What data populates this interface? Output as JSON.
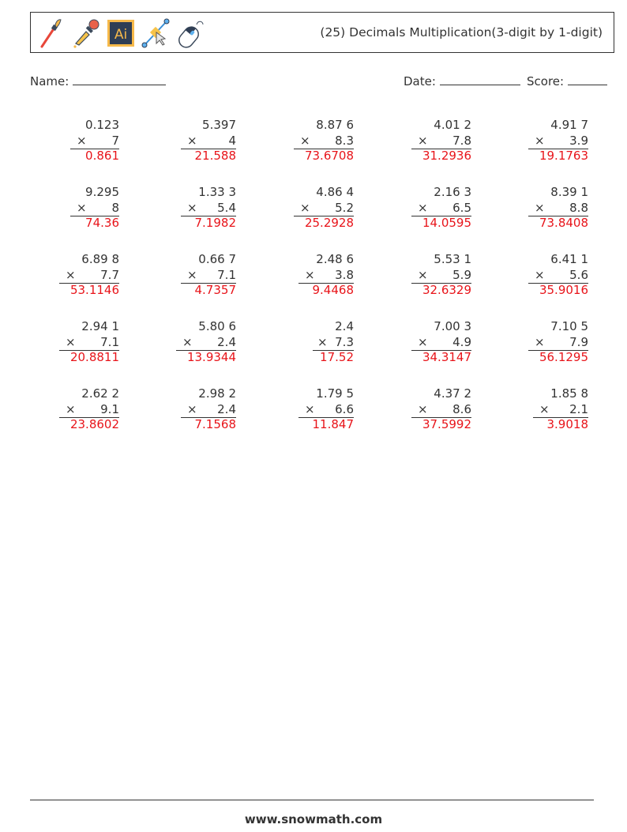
{
  "header": {
    "icons": [
      "paintbrush-icon",
      "eyedropper-icon",
      "illustrator-icon",
      "pen-tool-icon",
      "mouse-icon"
    ],
    "illustrator_label": "Ai",
    "title": "(25) Decimals Multiplication(3-digit by 1-digit)"
  },
  "fields": {
    "name_label": "Name:",
    "date_label": "Date:",
    "score_label": "Score:"
  },
  "operator": "×",
  "problems": [
    [
      {
        "top": "0.123",
        "bottom": "7",
        "answer": "0.861"
      },
      {
        "top": "5.397",
        "bottom": "4",
        "answer": "21.588"
      },
      {
        "top": "8.87 6",
        "bottom": "8.3",
        "answer": "73.6708"
      },
      {
        "top": "4.01 2",
        "bottom": "7.8",
        "answer": "31.2936"
      },
      {
        "top": "4.91 7",
        "bottom": "3.9",
        "answer": "19.1763"
      }
    ],
    [
      {
        "top": "9.295",
        "bottom": "8",
        "answer": "74.36"
      },
      {
        "top": "1.33 3",
        "bottom": "5.4",
        "answer": "7.1982"
      },
      {
        "top": "4.86 4",
        "bottom": "5.2",
        "answer": "25.2928"
      },
      {
        "top": "2.16 3",
        "bottom": "6.5",
        "answer": "14.0595"
      },
      {
        "top": "8.39 1",
        "bottom": "8.8",
        "answer": "73.8408"
      }
    ],
    [
      {
        "top": "6.89 8",
        "bottom": "7.7",
        "answer": "53.1146"
      },
      {
        "top": "0.66 7",
        "bottom": "7.1",
        "answer": "4.7357"
      },
      {
        "top": "2.48 6",
        "bottom": "3.8",
        "answer": "9.4468"
      },
      {
        "top": "5.53 1",
        "bottom": "5.9",
        "answer": "32.6329"
      },
      {
        "top": "6.41 1",
        "bottom": "5.6",
        "answer": "35.9016"
      }
    ],
    [
      {
        "top": "2.94 1",
        "bottom": "7.1",
        "answer": "20.8811"
      },
      {
        "top": "5.80 6",
        "bottom": "2.4",
        "answer": "13.9344"
      },
      {
        "top": "2.4",
        "bottom": "7.3",
        "answer": "17.52"
      },
      {
        "top": "7.00 3",
        "bottom": "4.9",
        "answer": "34.3147"
      },
      {
        "top": "7.10 5",
        "bottom": "7.9",
        "answer": "56.1295"
      }
    ],
    [
      {
        "top": "2.62 2",
        "bottom": "9.1",
        "answer": "23.8602"
      },
      {
        "top": "2.98 2",
        "bottom": "2.4",
        "answer": "7.1568"
      },
      {
        "top": "1.79 5",
        "bottom": "6.6",
        "answer": "11.847"
      },
      {
        "top": "4.37 2",
        "bottom": "8.6",
        "answer": "37.5992"
      },
      {
        "top": "1.85 8",
        "bottom": "2.1",
        "answer": "3.9018"
      }
    ]
  ],
  "footer": {
    "site": "www.snowmath.com"
  },
  "colors": {
    "answer": "#e8141a",
    "text": "#333333"
  }
}
